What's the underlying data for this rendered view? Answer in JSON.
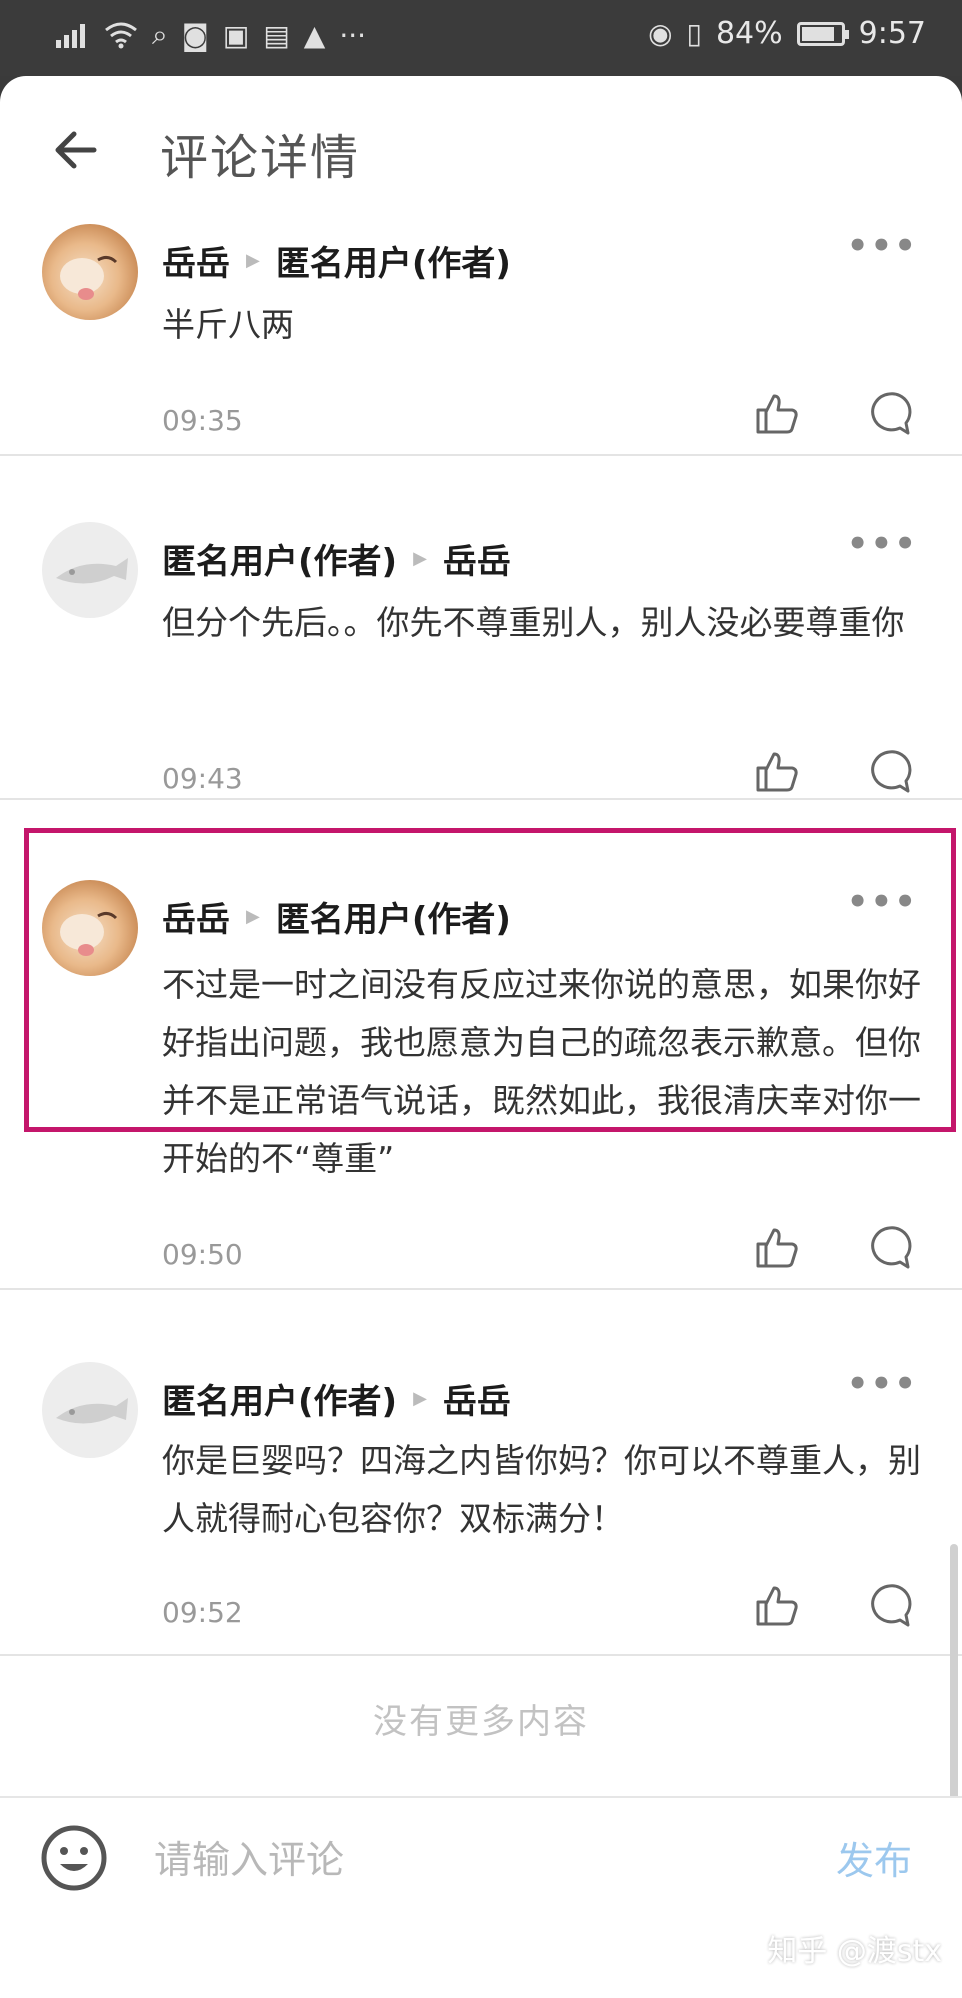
{
  "status_bar": {
    "signal_icon": "signal-icon",
    "battery_percent": "84%",
    "battery_level": 0.84,
    "time": "9:57"
  },
  "header": {
    "title": "评论详情"
  },
  "comments": [
    {
      "author": "岳岳",
      "reply_to": "匿名用户(作者)",
      "text": "半斤八两",
      "time": "09:35",
      "avatar": "cat"
    },
    {
      "author": "匿名用户(作者)",
      "reply_to": "岳岳",
      "text": "但分个先后。。你先不尊重别人，别人没必要尊重你",
      "time": "09:43",
      "avatar": "anon"
    },
    {
      "author": "岳岳",
      "reply_to": "匿名用户(作者)",
      "text": "不过是一时之间没有反应过来你说的意思，如果你好好指出问题，我也愿意为自己的疏忽表示歉意。但你并不是正常语气说话，既然如此，我很清庆幸对你一开始的不“尊重”",
      "time": "09:50",
      "avatar": "cat"
    },
    {
      "author": "匿名用户(作者)",
      "reply_to": "岳岳",
      "text": "你是巨婴吗？四海之内皆你妈？你可以不尊重人，别人就得耐心包容你？双标满分！",
      "time": "09:52",
      "avatar": "anon"
    }
  ],
  "footer": {
    "no_more": "没有更多内容"
  },
  "input": {
    "placeholder": "请输入评论",
    "publish_label": "发布"
  },
  "watermark": "知乎 @渡stx",
  "colors": {
    "highlight": "#c4166b",
    "publish": "#9cc8ee"
  }
}
